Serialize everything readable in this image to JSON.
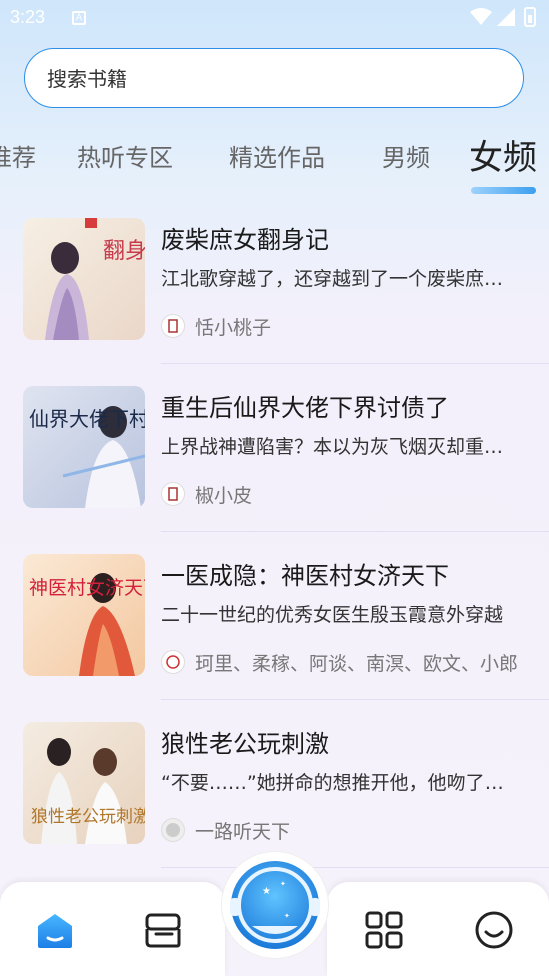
{
  "status_bar": {
    "time": "3:23"
  },
  "search": {
    "placeholder": "搜索书籍"
  },
  "tabs": [
    {
      "label": "推荐"
    },
    {
      "label": "热听专区"
    },
    {
      "label": "精选作品"
    },
    {
      "label": "男频"
    },
    {
      "label": "女频",
      "active": true
    }
  ],
  "books": [
    {
      "title": "废柴庶女翻身记",
      "desc": "江北歌穿越了，还穿越到了一个废柴庶女身上",
      "author": "恬小桃子",
      "cover_text": "翻身记"
    },
    {
      "title": "重生后仙界大佬下界讨债了",
      "desc": "上界战神遭陷害？本以为灰飞烟灭却重生了",
      "author": "椒小皮",
      "cover_text": "仙界大佬下村讨债"
    },
    {
      "title": "一医成隐：神医村女济天下",
      "desc": "二十一世纪的优秀女医生殷玉霞意外穿越",
      "author": "珂里、柔稼、阿谈、南溟、欧文、小郎",
      "cover_text": "神医村女济天下"
    },
    {
      "title": "狼性老公玩刺激",
      "desc": "“不要……”她拼命的想推开他，他吻了下来",
      "author": "一路听天下",
      "cover_text": "狼性老公玩刺激"
    }
  ],
  "colors": {
    "accent": "#2d8fe8",
    "tab_active": "#222222"
  },
  "bottom_nav": {
    "items": [
      {
        "icon": "home-icon"
      },
      {
        "icon": "bookshelf-icon"
      },
      {
        "icon": "player-astronaut-icon"
      },
      {
        "icon": "grid-icon"
      },
      {
        "icon": "profile-smile-icon"
      }
    ]
  }
}
